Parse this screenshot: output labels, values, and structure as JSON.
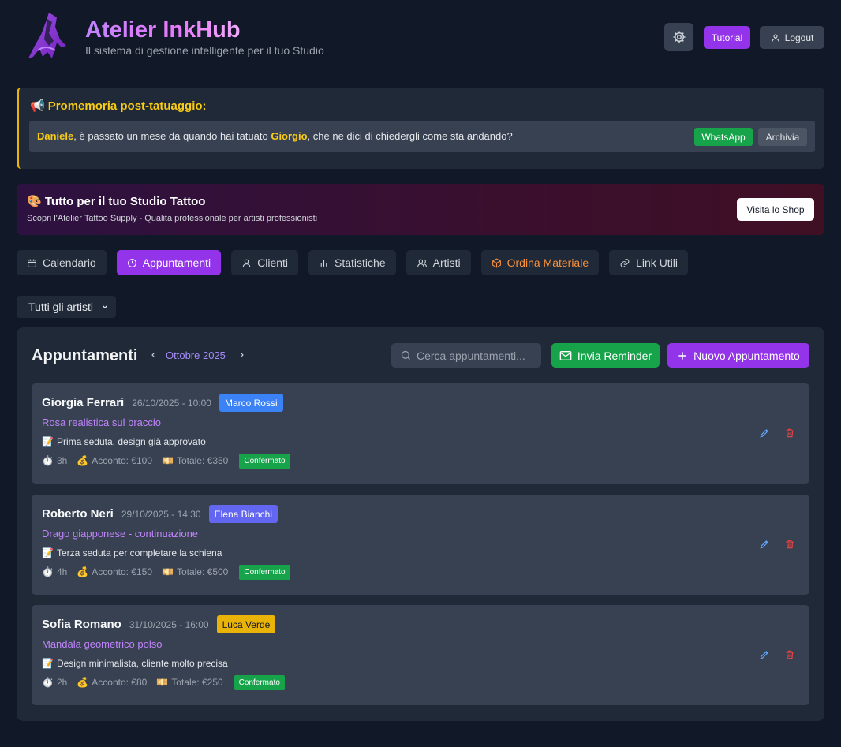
{
  "header": {
    "title": "Atelier InkHub",
    "subtitle": "Il sistema di gestione intelligente per il tuo Studio",
    "tutorial_label": "Tutorial",
    "logout_label": "Logout"
  },
  "reminder": {
    "icon": "📢",
    "title": "Promemoria post-tatuaggio:",
    "artist_name": "Daniele",
    "text_part1": ", è passato un mese da quando hai tatuato ",
    "client_name": "Giorgio",
    "text_part2": ", che ne dici di chiedergli come sta andando?",
    "whatsapp_label": "WhatsApp",
    "archive_label": "Archivia"
  },
  "shop": {
    "icon": "🎨",
    "title": "Tutto per il tuo Studio Tattoo",
    "subtitle": "Scopri l'Atelier Tattoo Supply - Qualità professionale per artisti professionisti",
    "button_label": "Visita lo Shop"
  },
  "nav": {
    "calendar": "Calendario",
    "appointments": "Appuntamenti",
    "clients": "Clienti",
    "stats": "Statistiche",
    "artists": "Artisti",
    "order": "Ordina Materiale",
    "links": "Link Utili"
  },
  "filter": {
    "selected": "Tutti gli artisti"
  },
  "panel": {
    "title": "Appuntamenti",
    "month": "Ottobre 2025",
    "search_placeholder": "Cerca appuntamenti...",
    "send_reminder_label": "Invia Reminder",
    "new_appointment_label": "Nuovo Appuntamento"
  },
  "appointments": [
    {
      "client": "Giorgia Ferrari",
      "datetime": "26/10/2025 - 10:00",
      "artist": "Marco Rossi",
      "artist_color": "#3b82f6",
      "title": "Rosa realistica sul braccio",
      "note_icon": "📝",
      "note": "Prima seduta, design già approvato",
      "duration_icon": "⏱️",
      "duration": "3h",
      "deposit_icon": "💰",
      "deposit": "Acconto: €100",
      "total_icon": "💴",
      "total": "Totale: €350",
      "status": "Confermato"
    },
    {
      "client": "Roberto Neri",
      "datetime": "29/10/2025 - 14:30",
      "artist": "Elena Bianchi",
      "artist_color": "#6366f1",
      "title": "Drago giapponese - continuazione",
      "note_icon": "📝",
      "note": "Terza seduta per completare la schiena",
      "duration_icon": "⏱️",
      "duration": "4h",
      "deposit_icon": "💰",
      "deposit": "Acconto: €150",
      "total_icon": "💴",
      "total": "Totale: €500",
      "status": "Confermato"
    },
    {
      "client": "Sofia Romano",
      "datetime": "31/10/2025 - 16:00",
      "artist": "Luca Verde",
      "artist_color": "#eab308",
      "title": "Mandala geometrico polso",
      "note_icon": "📝",
      "note": "Design minimalista, cliente molto precisa",
      "duration_icon": "⏱️",
      "duration": "2h",
      "deposit_icon": "💰",
      "deposit": "Acconto: €80",
      "total_icon": "💴",
      "total": "Totale: €250",
      "status": "Confermato"
    }
  ]
}
